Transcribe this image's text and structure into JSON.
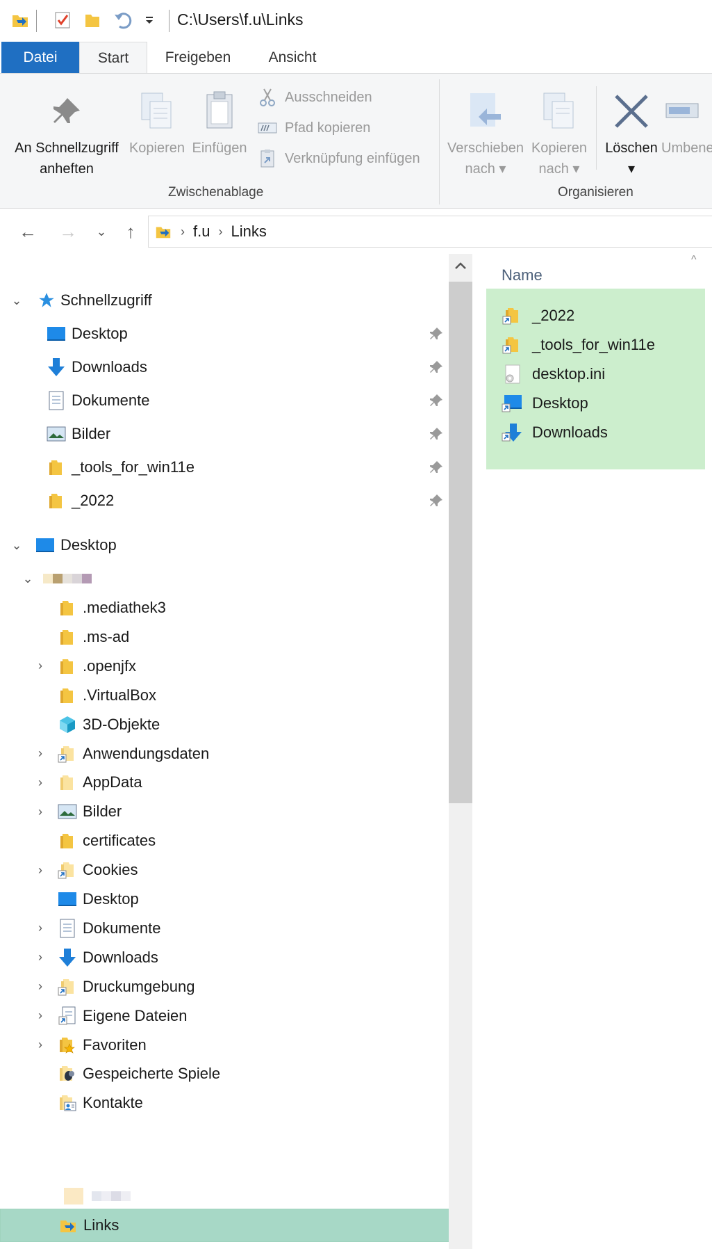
{
  "title": {
    "path": "C:\\Users\\f.u\\Links"
  },
  "ribbon_tabs": {
    "file": "Datei",
    "start": "Start",
    "share": "Freigeben",
    "view": "Ansicht"
  },
  "ribbon": {
    "pin_line1": "An Schnellzugriff",
    "pin_line2": "anheften",
    "copy": "Kopieren",
    "paste": "Einfügen",
    "cut": "Ausschneiden",
    "copy_path": "Pfad kopieren",
    "paste_shortcut": "Verknüpfung einfügen",
    "clipboard_group": "Zwischenablage",
    "move_line1": "Verschieben",
    "move_line2": "nach",
    "copyto_line1": "Kopieren",
    "copyto_line2": "nach",
    "delete": "Löschen",
    "rename": "Umbenen",
    "organize_group": "Organisieren"
  },
  "address": {
    "crumbs": [
      "f.u",
      "Links"
    ]
  },
  "nav": {
    "quick_access": "Schnellzugriff",
    "quick_items": [
      "Desktop",
      "Downloads",
      "Dokumente",
      "Bilder",
      "_tools_for_win11e",
      "_2022"
    ],
    "desktop": "Desktop",
    "user_items": [
      ".mediathek3",
      ".ms-ad",
      ".openjfx",
      ".VirtualBox",
      "3D-Objekte",
      "Anwendungsdaten",
      "AppData",
      "Bilder",
      "certificates",
      "Cookies",
      "Desktop",
      "Dokumente",
      "Downloads",
      "Druckumgebung",
      "Eigene Dateien",
      "Favoriten",
      "Gespeicherte Spiele",
      "Kontakte"
    ],
    "selected": "Links"
  },
  "filelist": {
    "header": "Name",
    "files": [
      "_2022",
      "_tools_for_win11e",
      "desktop.ini",
      "Desktop",
      "Downloads"
    ]
  },
  "colors": {
    "accent": "#1f6fc2",
    "selection": "#a7d8c6",
    "file_selection": "#cceecd",
    "folder": "#f4c542"
  }
}
